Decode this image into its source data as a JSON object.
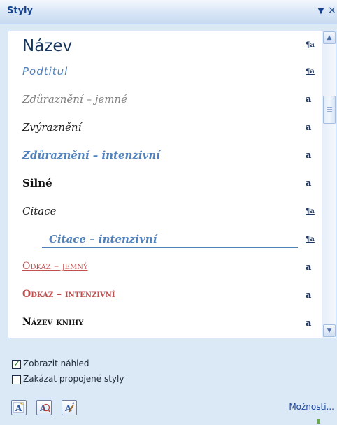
{
  "panel": {
    "title": "Styly",
    "options_label": "Možnosti..."
  },
  "styles": [
    {
      "name": "Název",
      "type": "paragraph",
      "mark": "¶a"
    },
    {
      "name": "Podtitul",
      "type": "paragraph",
      "mark": "¶a"
    },
    {
      "name": "Zdůraznění – jemné",
      "type": "character",
      "mark": "a"
    },
    {
      "name": "Zvýraznění",
      "type": "character",
      "mark": "a"
    },
    {
      "name": "Zdůraznění – intenzivní",
      "type": "character",
      "mark": "a"
    },
    {
      "name": "Silné",
      "type": "character",
      "mark": "a"
    },
    {
      "name": "Citace",
      "type": "paragraph",
      "mark": "¶a"
    },
    {
      "name": "Citace – intenzivní",
      "type": "paragraph",
      "mark": "¶a"
    },
    {
      "name": "Odkaz – jemný",
      "type": "character",
      "mark": "a"
    },
    {
      "name": "Odkaz – intenzivní",
      "type": "character",
      "mark": "a"
    },
    {
      "name": "Název knihy",
      "type": "character",
      "mark": "a"
    }
  ],
  "options": {
    "show_preview": {
      "label": "Zobrazit náhled",
      "checked": true
    },
    "disable_linked": {
      "label": "Zakázat propojené styly",
      "checked": false
    }
  },
  "toolbar": [
    {
      "name": "new-style",
      "glyph": "A"
    },
    {
      "name": "style-inspector",
      "glyph": "A"
    },
    {
      "name": "manage-styles",
      "glyph": "A"
    }
  ],
  "colors": {
    "title": "#15428b",
    "link": "#1a47a0",
    "style_blue": "#4f81bd",
    "style_red": "#c0504d"
  }
}
